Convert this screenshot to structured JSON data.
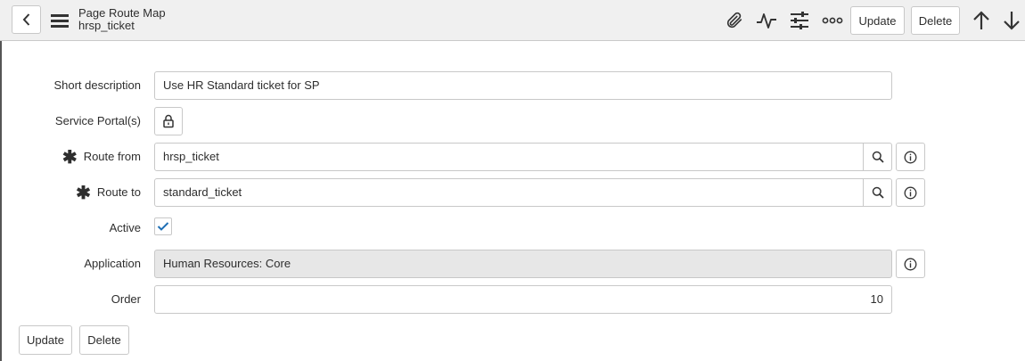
{
  "header": {
    "title": "Page Route Map",
    "subtitle": "hrsp_ticket",
    "update_label": "Update",
    "delete_label": "Delete"
  },
  "form": {
    "short_description": {
      "label": "Short description",
      "value": "Use HR Standard ticket for SP"
    },
    "service_portals": {
      "label": "Service Portal(s)"
    },
    "route_from": {
      "label": "Route from",
      "value": "hrsp_ticket",
      "required": true
    },
    "route_to": {
      "label": "Route to",
      "value": "standard_ticket",
      "required": true
    },
    "active": {
      "label": "Active",
      "checked": true
    },
    "application": {
      "label": "Application",
      "value": "Human Resources: Core"
    },
    "order": {
      "label": "Order",
      "value": "10"
    }
  },
  "footer": {
    "update_label": "Update",
    "delete_label": "Delete"
  },
  "colors": {
    "accent": "#1f6fb5",
    "header_bg": "#f0f0f0",
    "readonly_bg": "#e7e7e7"
  }
}
